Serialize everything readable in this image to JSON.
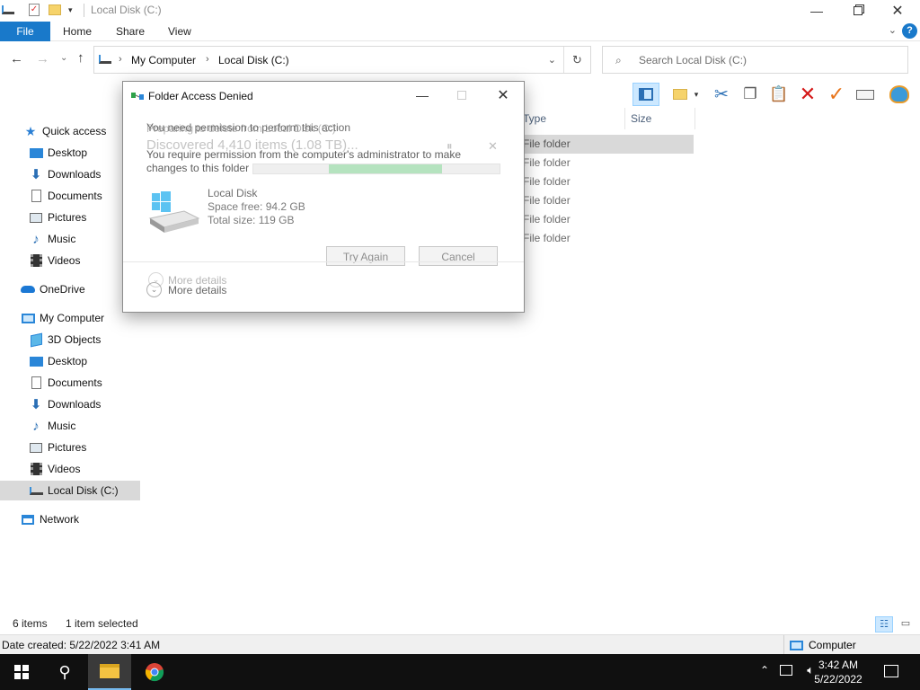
{
  "window": {
    "title": "Local Disk (C:)"
  },
  "ribbon": {
    "tabs": [
      "File",
      "Home",
      "Share",
      "View"
    ]
  },
  "address": {
    "crumbs": [
      "My Computer",
      "Local Disk (C:)"
    ]
  },
  "search": {
    "placeholder": "Search Local Disk (C:)"
  },
  "sidebar": {
    "quick_access": "Quick access",
    "quick_items": [
      "Desktop",
      "Downloads",
      "Documents",
      "Pictures",
      "Music",
      "Videos"
    ],
    "onedrive": "OneDrive",
    "my_computer": "My Computer",
    "computer_items": [
      "3D Objects",
      "Desktop",
      "Documents",
      "Downloads",
      "Music",
      "Pictures",
      "Videos",
      "Local Disk (C:)"
    ],
    "network": "Network"
  },
  "columns": {
    "type": "Type",
    "size": "Size"
  },
  "rows": [
    "File folder",
    "File folder",
    "File folder",
    "File folder",
    "File folder",
    "File folder"
  ],
  "status": {
    "items": "6 items",
    "selected": "1 item selected"
  },
  "details": {
    "date_created": "Date created: 5/22/2022 3:41 AM",
    "location": "Computer"
  },
  "taskbar": {
    "time": "3:42 AM",
    "date": "5/22/2022"
  },
  "dialog": {
    "title": "Folder Access Denied",
    "ghost_line1": "Preparing to delete from Local Disk (C:)",
    "ghost_discovered": "Discovered 4,410 items (1.08 TB)...",
    "message1": "You need permission to perform this action",
    "message2": "You require permission from the computer's administrator to make",
    "message3": "changes to this folder",
    "item_name": "Local Disk",
    "space_free": "Space free: 94.2 GB",
    "total_size": "Total size: 119 GB",
    "try_again": "Try Again",
    "cancel": "Cancel",
    "more_details_ghost": "More details",
    "more_details": "More details",
    "progress": 0.46
  },
  "colors": {
    "accent": "#1979ca",
    "selected_bg": "#d9d9d9",
    "taskbar": "#101010"
  }
}
